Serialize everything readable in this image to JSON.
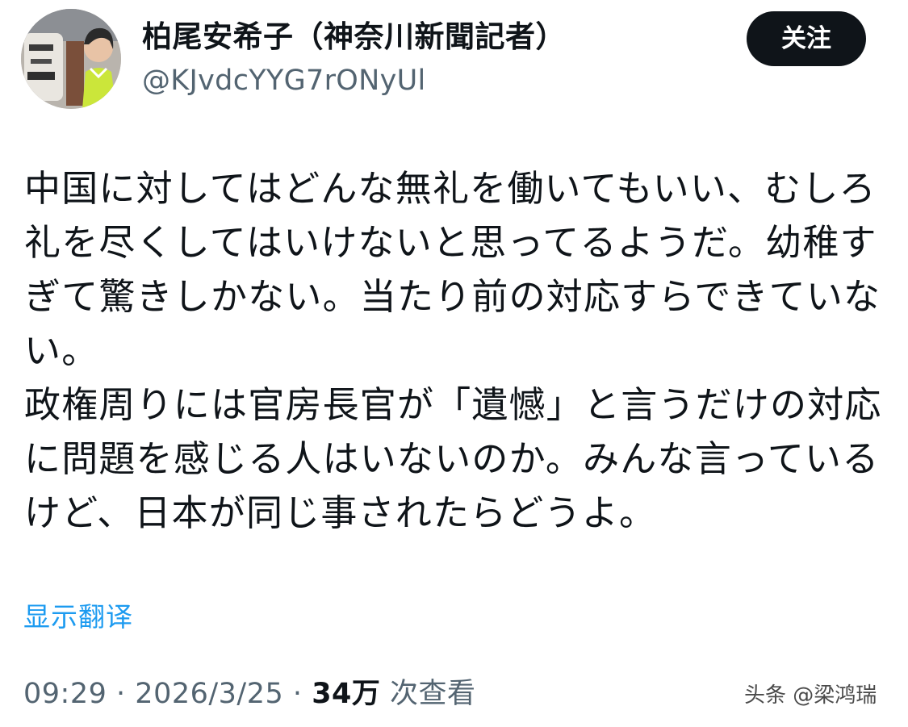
{
  "user": {
    "display_name": "柏尾安希子（神奈川新聞記者）",
    "handle": "@KJvdcYYG7rONyUl",
    "follow_label": "关注"
  },
  "tweet": {
    "paragraphs": [
      "中国に対してはどんな無礼を働いてもいい、むしろ礼を尽くしてはいけないと思ってるようだ。幼稚すぎて驚きしかない。当たり前の対応すらできていない。",
      "政権周りには官房長官が「遺憾」と言うだけの対応に問題を感じる人はいないのか。みんな言っているけど、日本が同じ事されたらどうよ。"
    ],
    "translate_label": "显示翻译"
  },
  "meta": {
    "time": "09:29",
    "separator": "·",
    "date": "2026/3/25",
    "views_count": "34万",
    "views_label": "次查看"
  },
  "watermark": "头条 @梁鸿瑞",
  "colors": {
    "text_primary": "#0f1419",
    "text_secondary": "#536471",
    "link": "#1d9bf0",
    "button_bg": "#0f1419",
    "button_text": "#ffffff",
    "background": "#ffffff"
  },
  "icons": {
    "avatar": "profile-photo"
  }
}
